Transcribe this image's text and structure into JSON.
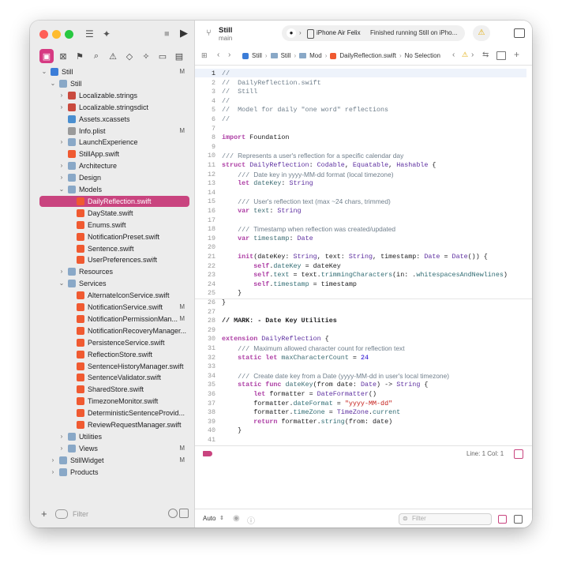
{
  "toolbar": {
    "project_name": "Still",
    "branch": "main",
    "scheme_target": "iPhone Air Felix",
    "status": "Finished running Still on iPho..."
  },
  "navigator": {
    "tabs": [
      "folder-icon",
      "source-control-icon",
      "bookmark-icon",
      "search-icon",
      "warning-icon",
      "test-icon",
      "debug-icon",
      "breakpoint-icon",
      "report-icon"
    ],
    "filter_placeholder": "Filter",
    "tree": [
      {
        "label": "Still",
        "kind": "proj",
        "indent": 0,
        "disclosure": "open",
        "badge": "M"
      },
      {
        "label": "Still",
        "kind": "folder",
        "indent": 1,
        "disclosure": "open",
        "badge": ""
      },
      {
        "label": "Localizable.strings",
        "kind": "strings",
        "indent": 2,
        "disclosure": "closed",
        "badge": ""
      },
      {
        "label": "Localizable.stringsdict",
        "kind": "strings",
        "indent": 2,
        "disclosure": "closed",
        "badge": ""
      },
      {
        "label": "Assets.xcassets",
        "kind": "assets",
        "indent": 2,
        "disclosure": "",
        "badge": ""
      },
      {
        "label": "Info.plist",
        "kind": "plist",
        "indent": 2,
        "disclosure": "",
        "badge": "M"
      },
      {
        "label": "LaunchExperience",
        "kind": "folder",
        "indent": 2,
        "disclosure": "closed",
        "badge": ""
      },
      {
        "label": "StillApp.swift",
        "kind": "swift",
        "indent": 2,
        "disclosure": "",
        "badge": ""
      },
      {
        "label": "Architecture",
        "kind": "folder",
        "indent": 2,
        "disclosure": "closed",
        "badge": ""
      },
      {
        "label": "Design",
        "kind": "folder",
        "indent": 2,
        "disclosure": "closed",
        "badge": ""
      },
      {
        "label": "Models",
        "kind": "folder",
        "indent": 2,
        "disclosure": "open",
        "badge": ""
      },
      {
        "label": "DailyReflection.swift",
        "kind": "swift",
        "indent": 3,
        "disclosure": "",
        "badge": "",
        "selected": true
      },
      {
        "label": "DayState.swift",
        "kind": "swift",
        "indent": 3,
        "disclosure": "",
        "badge": ""
      },
      {
        "label": "Enums.swift",
        "kind": "swift",
        "indent": 3,
        "disclosure": "",
        "badge": ""
      },
      {
        "label": "NotificationPreset.swift",
        "kind": "swift",
        "indent": 3,
        "disclosure": "",
        "badge": ""
      },
      {
        "label": "Sentence.swift",
        "kind": "swift",
        "indent": 3,
        "disclosure": "",
        "badge": ""
      },
      {
        "label": "UserPreferences.swift",
        "kind": "swift",
        "indent": 3,
        "disclosure": "",
        "badge": ""
      },
      {
        "label": "Resources",
        "kind": "folder",
        "indent": 2,
        "disclosure": "closed",
        "badge": ""
      },
      {
        "label": "Services",
        "kind": "folder",
        "indent": 2,
        "disclosure": "open",
        "badge": ""
      },
      {
        "label": "AlternateIconService.swift",
        "kind": "swift",
        "indent": 3,
        "disclosure": "",
        "badge": ""
      },
      {
        "label": "NotificationService.swift",
        "kind": "swift",
        "indent": 3,
        "disclosure": "",
        "badge": "M"
      },
      {
        "label": "NotificationPermissionMan...",
        "kind": "swift",
        "indent": 3,
        "disclosure": "",
        "badge": "M"
      },
      {
        "label": "NotificationRecoveryManager...",
        "kind": "swift",
        "indent": 3,
        "disclosure": "",
        "badge": ""
      },
      {
        "label": "PersistenceService.swift",
        "kind": "swift",
        "indent": 3,
        "disclosure": "",
        "badge": ""
      },
      {
        "label": "ReflectionStore.swift",
        "kind": "swift",
        "indent": 3,
        "disclosure": "",
        "badge": ""
      },
      {
        "label": "SentenceHistoryManager.swift",
        "kind": "swift",
        "indent": 3,
        "disclosure": "",
        "badge": ""
      },
      {
        "label": "SentenceValidator.swift",
        "kind": "swift",
        "indent": 3,
        "disclosure": "",
        "badge": ""
      },
      {
        "label": "SharedStore.swift",
        "kind": "swift",
        "indent": 3,
        "disclosure": "",
        "badge": ""
      },
      {
        "label": "TimezoneMonitor.swift",
        "kind": "swift",
        "indent": 3,
        "disclosure": "",
        "badge": ""
      },
      {
        "label": "DeterministicSentenceProvid...",
        "kind": "swift",
        "indent": 3,
        "disclosure": "",
        "badge": ""
      },
      {
        "label": "ReviewRequestManager.swift",
        "kind": "swift",
        "indent": 3,
        "disclosure": "",
        "badge": ""
      },
      {
        "label": "Utilities",
        "kind": "folder",
        "indent": 2,
        "disclosure": "closed",
        "badge": ""
      },
      {
        "label": "Views",
        "kind": "folder",
        "indent": 2,
        "disclosure": "closed",
        "badge": "M"
      },
      {
        "label": "StillWidget",
        "kind": "folder",
        "indent": 1,
        "disclosure": "closed",
        "badge": "M"
      },
      {
        "label": "Products",
        "kind": "folder",
        "indent": 1,
        "disclosure": "closed",
        "badge": ""
      }
    ]
  },
  "jumpbar": {
    "crumbs": [
      "Still",
      "Still",
      "Mod",
      "DailyReflection.swift",
      "No Selection"
    ]
  },
  "editor": {
    "current_line": 1,
    "lines": [
      {
        "n": 1,
        "h": "<span class='cmm'>//</span>"
      },
      {
        "n": 2,
        "h": "<span class='cmm'>//  DailyReflection.swift</span>"
      },
      {
        "n": 3,
        "h": "<span class='cmm'>//  Still</span>"
      },
      {
        "n": 4,
        "h": "<span class='cmm'>//</span>"
      },
      {
        "n": 5,
        "h": "<span class='cmm'>//  Model for daily \"one word\" reflections</span>"
      },
      {
        "n": 6,
        "h": "<span class='cmm'>//</span>"
      },
      {
        "n": 7,
        "h": ""
      },
      {
        "n": 8,
        "h": "<span class='kw'>import</span> Foundation"
      },
      {
        "n": 9,
        "h": ""
      },
      {
        "n": 10,
        "h": "<span class='cmm'>///</span> <span class='cm'>Represents a user's reflection for a specific calendar day</span>"
      },
      {
        "n": 11,
        "h": "<span class='kw'>struct</span> <span class='ty'>DailyReflection</span>: <span class='ty'>Codable</span>, <span class='ty'>Equatable</span>, <span class='ty'>Hashable</span> {"
      },
      {
        "n": 12,
        "h": "    <span class='cmm'>///</span> <span class='cm'>Date key in yyyy-MM-dd format (local timezone)</span>"
      },
      {
        "n": 13,
        "h": "    <span class='kw'>let</span> <span class='pr'>dateKey</span>: <span class='ty'>String</span>"
      },
      {
        "n": 14,
        "h": ""
      },
      {
        "n": 15,
        "h": "    <span class='cmm'>///</span> <span class='cm'>User's reflection text (max ~24 chars, trimmed)</span>"
      },
      {
        "n": 16,
        "h": "    <span class='kw'>var</span> <span class='pr'>text</span>: <span class='ty'>String</span>"
      },
      {
        "n": 17,
        "h": ""
      },
      {
        "n": 18,
        "h": "    <span class='cmm'>///</span> <span class='cm'>Timestamp when reflection was created/updated</span>"
      },
      {
        "n": 19,
        "h": "    <span class='kw'>var</span> <span class='pr'>timestamp</span>: <span class='ty'>Date</span>"
      },
      {
        "n": 20,
        "h": ""
      },
      {
        "n": 21,
        "h": "    <span class='kw'>init</span>(dateKey: <span class='ty'>String</span>, text: <span class='ty'>String</span>, timestamp: <span class='ty'>Date</span> = <span class='ty'>Date</span>()) {"
      },
      {
        "n": 22,
        "h": "        <span class='kw'>self</span>.<span class='fn'>dateKey</span> = dateKey"
      },
      {
        "n": 23,
        "h": "        <span class='kw'>self</span>.<span class='fn'>text</span> = text.<span class='fn'>trimmingCharacters</span>(in: .<span class='fn'>whitespacesAndNewlines</span>)"
      },
      {
        "n": 24,
        "h": "        <span class='kw'>self</span>.<span class='fn'>timestamp</span> = timestamp"
      },
      {
        "n": 25,
        "h": "    }"
      },
      {
        "n": 26,
        "h": "}"
      },
      {
        "n": 27,
        "h": ""
      },
      {
        "n": 28,
        "h": "<span class='mk'>// MARK: - Date Key Utilities</span>"
      },
      {
        "n": 29,
        "h": ""
      },
      {
        "n": 30,
        "h": "<span class='kw'>extension</span> <span class='ty'>DailyReflection</span> {"
      },
      {
        "n": 31,
        "h": "    <span class='cmm'>///</span> <span class='cm'>Maximum allowed character count for reflection text</span>"
      },
      {
        "n": 32,
        "h": "    <span class='kw'>static let</span> <span class='pr'>maxCharacterCount</span> = <span class='nm'>24</span>"
      },
      {
        "n": 33,
        "h": ""
      },
      {
        "n": 34,
        "h": "    <span class='cmm'>///</span> <span class='cm'>Create date key from a Date (yyyy-MM-dd in user's local timezone)</span>"
      },
      {
        "n": 35,
        "h": "    <span class='kw'>static func</span> <span class='pr'>dateKey</span>(from date: <span class='ty'>Date</span>) -> <span class='ty'>String</span> {"
      },
      {
        "n": 36,
        "h": "        <span class='kw'>let</span> formatter = <span class='ty'>DateFormatter</span>()"
      },
      {
        "n": 37,
        "h": "        formatter.<span class='fn'>dateFormat</span> = <span class='st'>\"yyyy-MM-dd\"</span>"
      },
      {
        "n": 38,
        "h": "        formatter.<span class='fn'>timeZone</span> = <span class='ty'>TimeZone</span>.<span class='fn'>current</span>"
      },
      {
        "n": 39,
        "h": "        <span class='kw'>return</span> formatter.<span class='fn'>string</span>(from: date)"
      },
      {
        "n": 40,
        "h": "    }"
      },
      {
        "n": 41,
        "h": ""
      }
    ]
  },
  "status": {
    "line_col": "Line: 1  Col: 1"
  },
  "bottom": {
    "mode": "Auto",
    "filter_placeholder": "Filter"
  },
  "colors": {
    "accent": "#c9447f",
    "sidebar_bg": "#ececec"
  }
}
